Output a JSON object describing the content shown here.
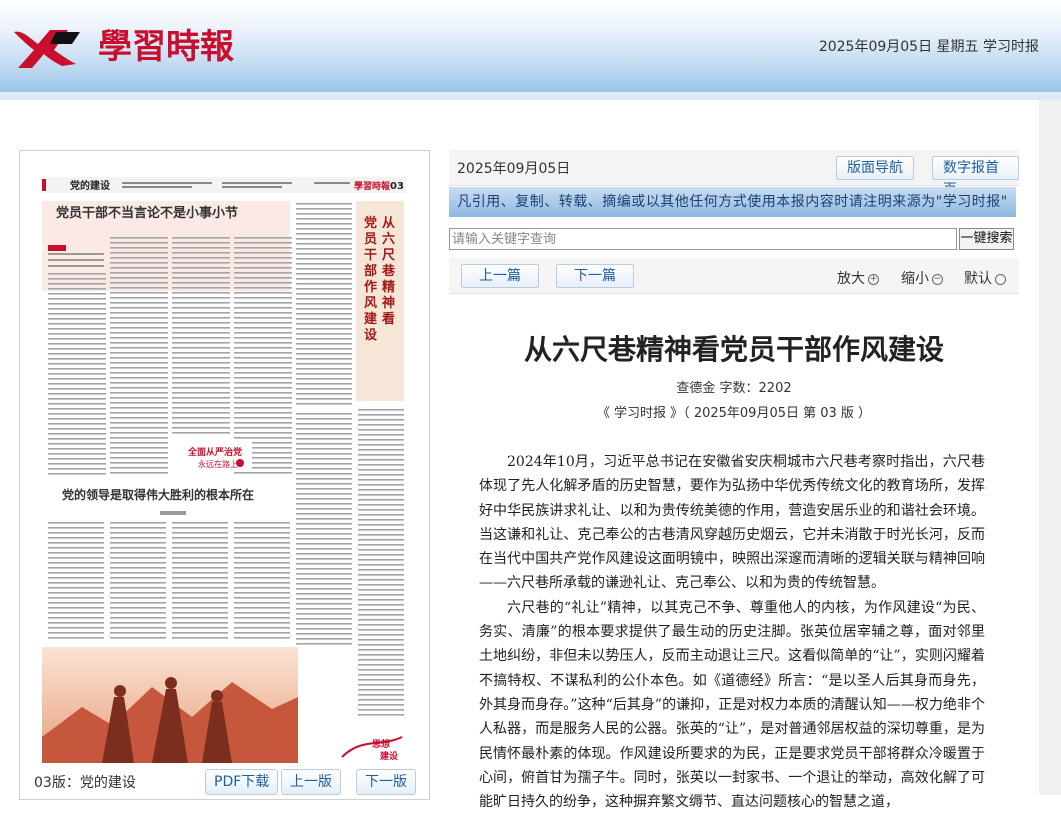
{
  "header": {
    "logo_text": "學習時報",
    "date_line": "2025年09月05日 星期五 学习时报"
  },
  "left_panel": {
    "page_label": "03版：党的建设",
    "pdf_button": "PDF下载",
    "prev_page_button": "上一版",
    "next_page_button": "下一版",
    "newspaper": {
      "section": "党的建设",
      "page_no": "03",
      "headline1": "党员干部不当言论不是小事小节",
      "vertical_headline": "从六尺巷精神看党员干部作风建设",
      "headline2": "党的领导是取得伟大胜利的根本所在",
      "banner": "全面从严治党 永远在路上",
      "corner_tag": "思想 建设"
    }
  },
  "right_panel": {
    "date": "2025年09月05日",
    "layout_nav_button": "版面导航",
    "digital_home_button": "数字报首页",
    "notice": "凡引用、复制、转载、摘编或以其他任何方式使用本报内容时请注明来源为\"学习时报\"",
    "search": {
      "placeholder": "请输入关键字查询",
      "button": "一键搜索"
    },
    "prev_article": "上一篇",
    "next_article": "下一篇",
    "zoom_in": "放大",
    "zoom_out": "缩小",
    "zoom_default": "默认",
    "article": {
      "title": "从六尺巷精神看党员干部作风建设",
      "meta_author": "查德金 字数：2202",
      "meta_source": "《 学习时报 》（ 2025年09月05日 第 03 版 ）",
      "paragraphs": [
        "2024年10月，习近平总书记在安徽省安庆桐城市六尺巷考察时指出，六尺巷体现了先人化解矛盾的历史智慧，要作为弘扬中华优秀传统文化的教育场所，发挥好中华民族讲求礼让、以和为贵传统美德的作用，营造安居乐业的和谐社会环境。当这谦和礼让、克己奉公的古巷清风穿越历史烟云，它并未消散于时光长河，反而在当代中国共产党作风建设这面明镜中，映照出深邃而清晰的逻辑关联与精神回响——六尺巷所承载的谦逊礼让、克己奉公、以和为贵的传统智慧。",
        "六尺巷的“礼让”精神，以其克己不争、尊重他人的内核，为作风建设“为民、务实、清廉”的根本要求提供了最生动的历史注脚。张英位居宰辅之尊，面对邻里土地纠纷，非但未以势压人，反而主动退让三尺。这看似简单的“让”，实则闪耀着不搞特权、不谋私利的公仆本色。如《道德经》所言：“是以圣人后其身而身先，外其身而身存。”这种“后其身”的谦抑，正是对权力本质的清醒认知——权力绝非个人私器，而是服务人民的公器。张英的“让”，是对普通邻居权益的深切尊重，是为民情怀最朴素的体现。作风建设所要求的为民，正是要求党员干部将群众冷暖置于心间，俯首甘为孺子牛。同时，张英以一封家书、一个退让的举动，高效化解了可能旷日持久的纷争，这种摒弃繁文缛节、直达问题核心的智慧之道，"
      ]
    }
  },
  "colors": {
    "brand_red": "#c8102e",
    "link_blue": "#1f5fa0",
    "notice_text": "#1d3f74"
  }
}
